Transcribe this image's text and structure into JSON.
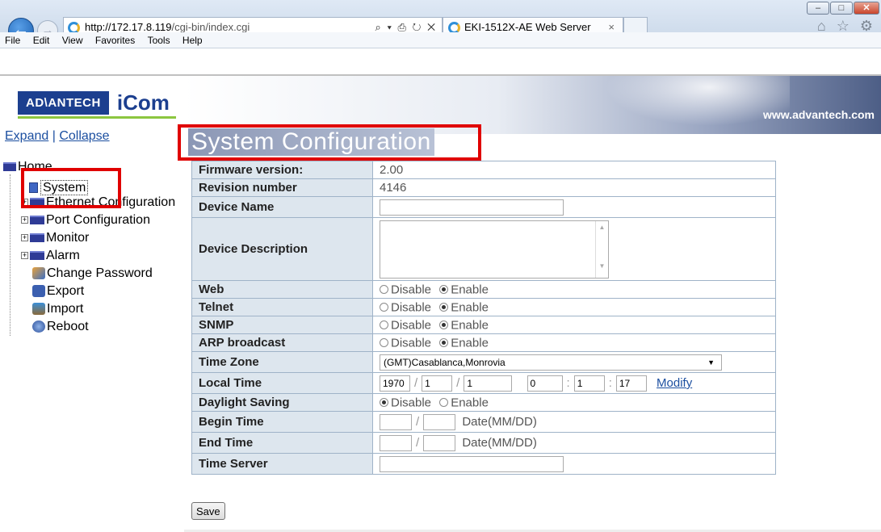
{
  "browser": {
    "url_host": "http://172.17.8.119",
    "url_path": "/cgi-bin/index.cgi",
    "address_tools": "⌕ ▾ ⎙ ↻ ✕",
    "tab_title": "EKI-1512X-AE Web Server",
    "tab_close": "×",
    "right_glyphs": "⌂ ☆ ⚙",
    "window_buttons": [
      "–",
      "□",
      "✕"
    ],
    "back_glyph": "←",
    "forward_glyph": "→",
    "menu": [
      "File",
      "Edit",
      "View",
      "Favorites",
      "Tools",
      "Help"
    ]
  },
  "header": {
    "logo_brand": "AD\\ANTECH",
    "logo_product": "iCom",
    "website": "www.advantech.com"
  },
  "sidebar": {
    "expand": "Expand",
    "divider": " | ",
    "collapse": "Collapse",
    "root": "Home",
    "items": [
      {
        "label": "System",
        "icon": "page-icon"
      },
      {
        "label": "Ethernet Configuration",
        "icon": "folder-icon"
      },
      {
        "label": "Port Configuration",
        "icon": "folder-icon"
      },
      {
        "label": "Monitor",
        "icon": "folder-icon"
      },
      {
        "label": "Alarm",
        "icon": "folder-icon"
      },
      {
        "label": "Change Password",
        "icon": "password-icon"
      },
      {
        "label": "Export",
        "icon": "export-icon"
      },
      {
        "label": "Import",
        "icon": "import-icon"
      },
      {
        "label": "Reboot",
        "icon": "reboot-icon"
      }
    ]
  },
  "main": {
    "title": "System Configuration",
    "firmware_label": "Firmware version:",
    "firmware_value": "2.00",
    "revision_label": "Revision number",
    "revision_value": "4146",
    "device_name_label": "Device Name",
    "device_name_value": "",
    "device_desc_label": "Device Description",
    "device_desc_value": "",
    "web_label": "Web",
    "telnet_label": "Telnet",
    "snmp_label": "SNMP",
    "arp_label": "ARP broadcast",
    "disable": "Disable",
    "enable": "Enable",
    "timezone_label": "Time Zone",
    "timezone_value": "(GMT)Casablanca,Monrovia",
    "localtime_label": "Local Time",
    "lt_year": "1970",
    "lt_month": "1",
    "lt_day": "1",
    "lt_hour": "0",
    "lt_min": "1",
    "lt_sec": "17",
    "slash": "/",
    "colon": ":",
    "modify": "Modify",
    "dst_label": "Daylight Saving",
    "begin_label": "Begin Time",
    "end_label": "End Time",
    "date_hint": "Date(MM/DD)",
    "timeserver_label": "Time Server",
    "timeserver_value": "",
    "save": "Save"
  },
  "colors": {
    "highlight_box": "#e00000",
    "label_bg": "#dde6ee",
    "link": "#1c4fa0"
  }
}
